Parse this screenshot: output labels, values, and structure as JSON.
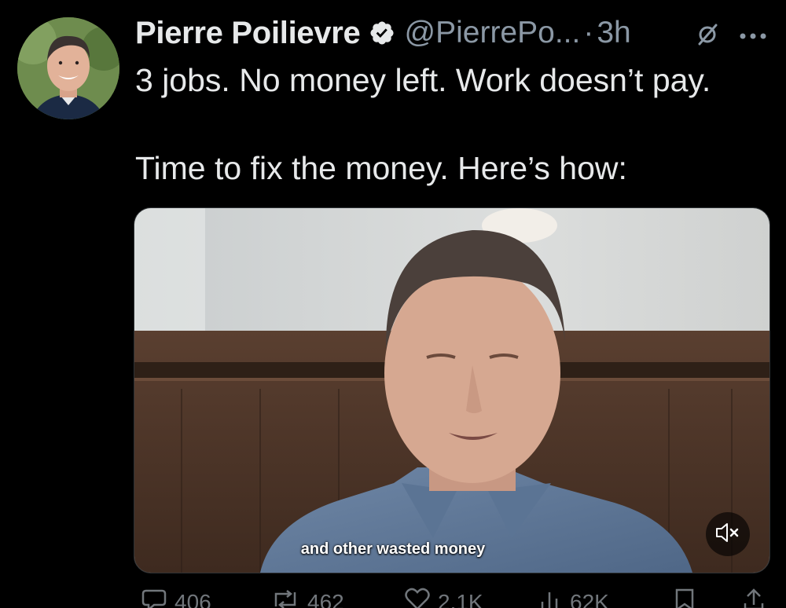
{
  "author": {
    "name": "Pierre Poilievre",
    "handle": "@PierrePo...",
    "separator": "·",
    "time": "3h",
    "verified": true,
    "verified_color": "#e7e9ea"
  },
  "tweet": {
    "text": "3 jobs. No money left. Work doesn’t pay.\n\nTime to fix the money. Here’s how:"
  },
  "video": {
    "caption": "and other wasted money",
    "muted": true
  },
  "actions": {
    "replies": "406",
    "reposts": "462",
    "likes": "2.1K",
    "views": "62K"
  },
  "icons": {
    "grok": "grok-icon",
    "more": "more-icon",
    "mute": "volume-mute-icon",
    "reply": "reply-icon",
    "repost": "repost-icon",
    "like": "heart-icon",
    "views": "views-icon",
    "bookmark": "bookmark-icon",
    "share": "share-icon"
  },
  "colors": {
    "background": "#000000",
    "text": "#e7e9ea",
    "secondary": "#8b98a5"
  }
}
